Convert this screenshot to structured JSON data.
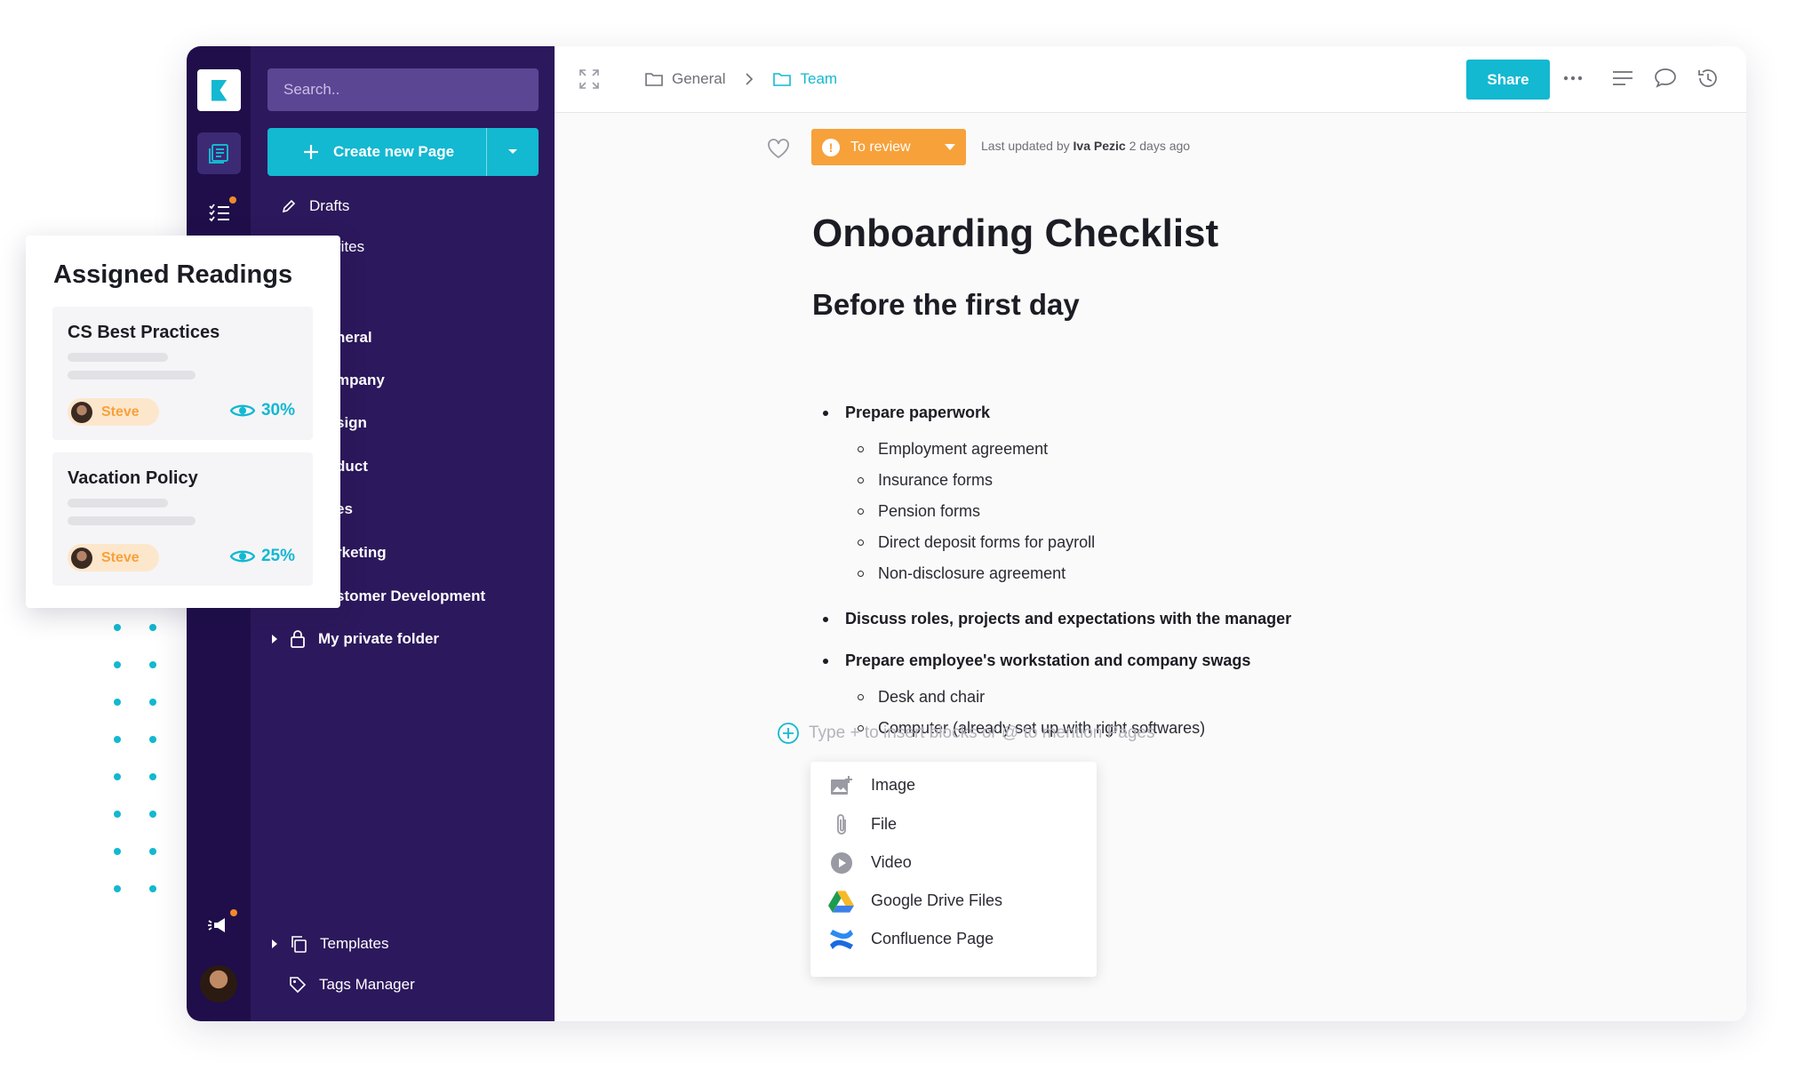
{
  "sidebar": {
    "search_placeholder": "Search..",
    "create_label": "Create new Page",
    "items": [
      {
        "label": "Drafts"
      },
      {
        "label": "rites"
      },
      {
        "label": "neral"
      },
      {
        "label": "mpany"
      },
      {
        "label": "sign"
      },
      {
        "label": "duct"
      },
      {
        "label": "es"
      },
      {
        "label": "rketing"
      },
      {
        "label": "stomer Development"
      },
      {
        "label": "My private folder"
      }
    ],
    "templates_label": "Templates",
    "tags_label": "Tags Manager"
  },
  "breadcrumb": [
    {
      "label": "General"
    },
    {
      "label": "Team"
    }
  ],
  "toolbar": {
    "share_label": "Share"
  },
  "status": {
    "label": "To review",
    "updated_prefix": "Last updated by",
    "updated_user": "Iva Pezic",
    "updated_when": "2 days ago"
  },
  "doc": {
    "title": "Onboarding Checklist",
    "heading": "Before the first day",
    "sections": [
      {
        "label": "Prepare paperwork",
        "children": [
          "Employment agreement",
          "Insurance forms",
          "Pension forms",
          "Direct deposit forms for payroll",
          "Non-disclosure agreement"
        ]
      },
      {
        "label": "Discuss roles, projects and expectations with the manager",
        "children": []
      },
      {
        "label": "Prepare employee's workstation and company swags",
        "children": [
          "Desk and chair",
          "Computer (already set up with right softwares)"
        ]
      }
    ],
    "insert_placeholder": "Type + to insert blocks or @ to mention Pages"
  },
  "block_menu": [
    {
      "label": "Image",
      "icon": "image-add-icon"
    },
    {
      "label": "File",
      "icon": "paperclip-icon"
    },
    {
      "label": "Video",
      "icon": "play-icon"
    },
    {
      "label": "Google Drive Files",
      "icon": "google-drive-icon"
    },
    {
      "label": "Confluence Page",
      "icon": "confluence-icon"
    }
  ],
  "help_label": "?",
  "assigned_readings": {
    "title": "Assigned Readings",
    "cards": [
      {
        "title": "CS Best Practices",
        "user": "Steve",
        "progress": "30%"
      },
      {
        "title": "Vacation Policy",
        "user": "Steve",
        "progress": "25%"
      }
    ]
  },
  "colors": {
    "accent": "#13b8d1",
    "sidebar": "#2c185c",
    "rail": "#1f0e4a",
    "status": "#f7a13b"
  }
}
